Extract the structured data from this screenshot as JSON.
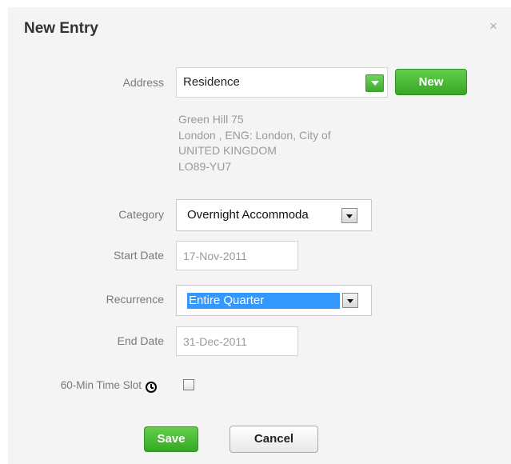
{
  "dialog": {
    "title": "New Entry",
    "close_icon": "close-icon"
  },
  "address": {
    "label": "Address",
    "selected": "Residence",
    "new_label": "New",
    "lines": [
      "Green Hill 75",
      "London , ENG: London, City of",
      "UNITED KINGDOM",
      "LO89-YU7"
    ]
  },
  "category": {
    "label": "Category",
    "selected": "Overnight Accommoda"
  },
  "start_date": {
    "label": "Start Date",
    "value": "17-Nov-2011"
  },
  "recurrence": {
    "label": "Recurrence",
    "selected": "Entire Quarter"
  },
  "end_date": {
    "label": "End Date",
    "value": "31-Dec-2011"
  },
  "time_slot": {
    "label": "60-Min Time Slot",
    "icon": "clock-icon",
    "checked": false
  },
  "actions": {
    "save_label": "Save",
    "cancel_label": "Cancel"
  },
  "colors": {
    "accent_green": "#3faa2e",
    "selection_blue": "#3399ff",
    "dialog_bg": "#f4f4f4"
  }
}
